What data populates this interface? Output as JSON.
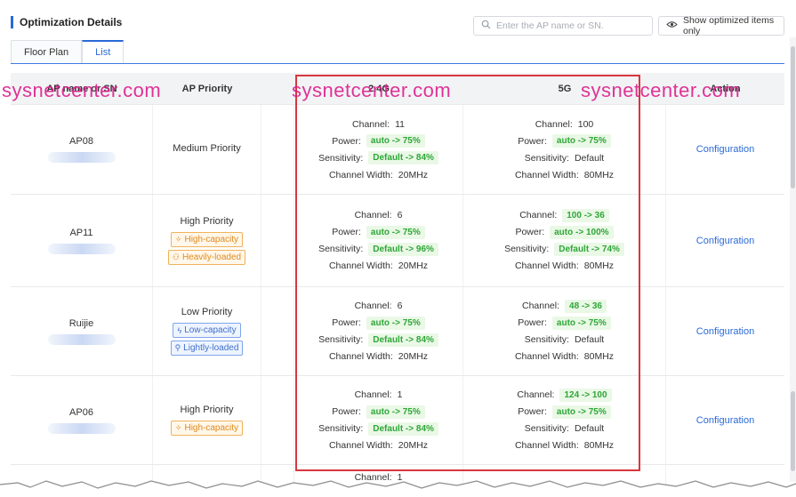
{
  "header": {
    "title": "Optimization Details",
    "search_placeholder": "Enter the AP name or SN.",
    "show_optimized_label": "Show optimized items only"
  },
  "tabs": [
    {
      "label": "Floor Plan",
      "active": false
    },
    {
      "label": "List",
      "active": true
    }
  ],
  "columns": {
    "ap": "AP name or SN",
    "priority": "AP Priority",
    "g24": "2.4G",
    "g5": "5G",
    "action": "Action"
  },
  "labels": {
    "channel": "Channel:",
    "power": "Power:",
    "sensitivity": "Sensitivity:",
    "channel_width": "Channel Width:"
  },
  "rows": [
    {
      "ap_name": "AP08",
      "priority": "Medium Priority",
      "tags": [],
      "g24": {
        "channel": "11",
        "channel_changed": false,
        "power": "auto -> 75%",
        "power_changed": true,
        "sensitivity": "Default -> 84%",
        "sensitivity_changed": true,
        "width": "20MHz"
      },
      "g5": {
        "channel": "100",
        "channel_changed": false,
        "power": "auto -> 75%",
        "power_changed": true,
        "sensitivity": "Default",
        "sensitivity_changed": false,
        "width": "80MHz"
      },
      "action": "Configuration"
    },
    {
      "ap_name": "AP11",
      "priority": "High Priority",
      "tags": [
        {
          "label": "High-capacity",
          "color": "orange",
          "icon": "sparkle-icon"
        },
        {
          "label": "Heavily-loaded",
          "color": "orange",
          "icon": "users-icon"
        }
      ],
      "g24": {
        "channel": "6",
        "channel_changed": false,
        "power": "auto -> 75%",
        "power_changed": true,
        "sensitivity": "Default -> 96%",
        "sensitivity_changed": true,
        "width": "20MHz"
      },
      "g5": {
        "channel": "100 -> 36",
        "channel_changed": true,
        "power": "auto -> 100%",
        "power_changed": true,
        "sensitivity": "Default -> 74%",
        "sensitivity_changed": true,
        "width": "80MHz"
      },
      "action": "Configuration"
    },
    {
      "ap_name": "Ruijie",
      "priority": "Low Priority",
      "tags": [
        {
          "label": "Low-capacity",
          "color": "blue",
          "icon": "bolt-icon"
        },
        {
          "label": "Lightly-loaded",
          "color": "blue",
          "icon": "user-icon"
        }
      ],
      "g24": {
        "channel": "6",
        "channel_changed": false,
        "power": "auto -> 75%",
        "power_changed": true,
        "sensitivity": "Default -> 84%",
        "sensitivity_changed": true,
        "width": "20MHz"
      },
      "g5": {
        "channel": "48 -> 36",
        "channel_changed": true,
        "power": "auto -> 75%",
        "power_changed": true,
        "sensitivity": "Default",
        "sensitivity_changed": false,
        "width": "80MHz"
      },
      "action": "Configuration"
    },
    {
      "ap_name": "AP06",
      "priority": "High Priority",
      "tags": [
        {
          "label": "High-capacity",
          "color": "orange",
          "icon": "sparkle-icon"
        }
      ],
      "g24": {
        "channel": "1",
        "channel_changed": false,
        "power": "auto -> 75%",
        "power_changed": true,
        "sensitivity": "Default -> 84%",
        "sensitivity_changed": true,
        "width": "20MHz"
      },
      "g5": {
        "channel": "124 -> 100",
        "channel_changed": true,
        "power": "auto -> 75%",
        "power_changed": true,
        "sensitivity": "Default",
        "sensitivity_changed": false,
        "width": "80MHz"
      },
      "action": "Configuration"
    }
  ],
  "partial_row": {
    "channel_label": "Channel:",
    "channel": "1"
  },
  "watermark": "sysnetcenter.com",
  "colors": {
    "accent": "#2a6ad8",
    "changed_value": "#2fa638",
    "highlight_box": "#d9363e",
    "watermark": "#dc1e8c"
  }
}
